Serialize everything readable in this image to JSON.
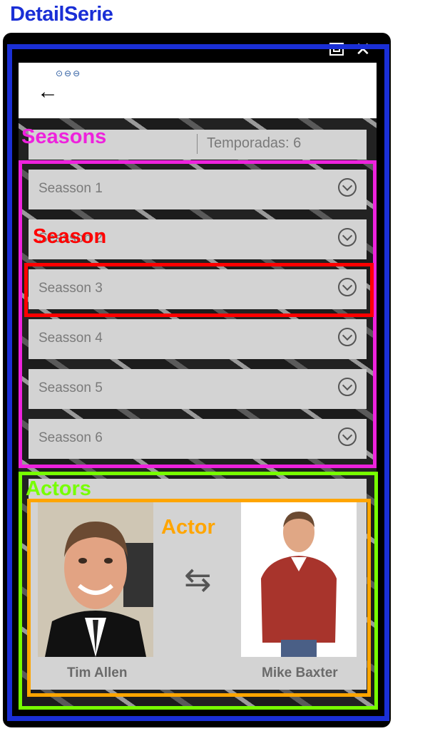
{
  "title": "DetailSerie",
  "header": {
    "temporadas": "Temporadas: 6"
  },
  "seasons": [
    {
      "label": "Seasson 1"
    },
    {
      "label": "Seasson 2"
    },
    {
      "label": "Seasson 3"
    },
    {
      "label": "Seasson 4"
    },
    {
      "label": "Seasson 5"
    },
    {
      "label": "Seasson 6"
    }
  ],
  "actor": {
    "actor_name": "Tim Allen",
    "character_name": "Mike Baxter"
  },
  "overlays": {
    "seasons": "Seasons",
    "season": "Season",
    "actors": "Actors",
    "actor": "Actor"
  },
  "colors": {
    "title": "#1a2fd6",
    "detail_frame": "#1a2fd6",
    "seasons_frame": "#ee22dd",
    "season_frame": "#ff0000",
    "actors_frame": "#77ff00",
    "actor_frame": "#ffa500"
  }
}
